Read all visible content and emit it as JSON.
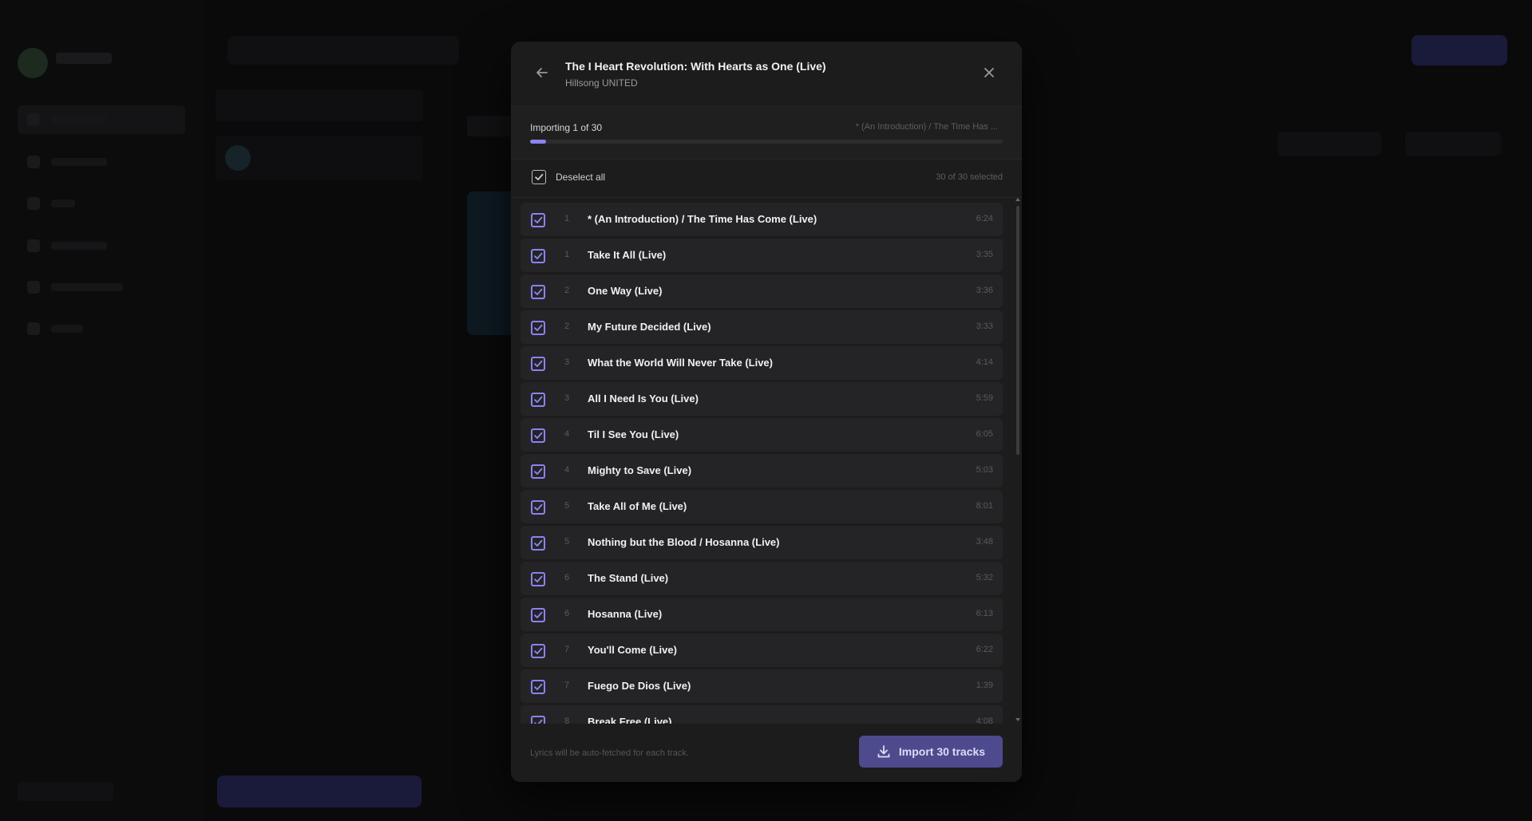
{
  "modal": {
    "title": "The I Heart Revolution: With Hearts as One (Live)",
    "artist": "Hillsong UNITED"
  },
  "progress": {
    "label": "Importing 1 of 30",
    "current_track": "* (An Introduction) / The Time Has ...",
    "fraction": 0.033
  },
  "selection": {
    "toggle_label": "Deselect all",
    "count_label": "30 of 30 selected"
  },
  "tracks": [
    {
      "num": "1",
      "name": "* (An Introduction) / The Time Has Come (Live)",
      "duration": "6:24"
    },
    {
      "num": "1",
      "name": "Take It All (Live)",
      "duration": "3:35"
    },
    {
      "num": "2",
      "name": "One Way (Live)",
      "duration": "3:36"
    },
    {
      "num": "2",
      "name": "My Future Decided (Live)",
      "duration": "3:33"
    },
    {
      "num": "3",
      "name": "What the World Will Never Take (Live)",
      "duration": "4:14"
    },
    {
      "num": "3",
      "name": "All I Need Is You (Live)",
      "duration": "5:59"
    },
    {
      "num": "4",
      "name": "Til I See You (Live)",
      "duration": "6:05"
    },
    {
      "num": "4",
      "name": "Mighty to Save (Live)",
      "duration": "5:03"
    },
    {
      "num": "5",
      "name": "Take All of Me (Live)",
      "duration": "8:01"
    },
    {
      "num": "5",
      "name": "Nothing but the Blood / Hosanna (Live)",
      "duration": "3:48"
    },
    {
      "num": "6",
      "name": "The Stand (Live)",
      "duration": "5:32"
    },
    {
      "num": "6",
      "name": "Hosanna (Live)",
      "duration": "6:13"
    },
    {
      "num": "7",
      "name": "You'll Come (Live)",
      "duration": "6:22"
    },
    {
      "num": "7",
      "name": "Fuego De Dios (Live)",
      "duration": "1:39"
    },
    {
      "num": "8",
      "name": "Break Free (Live)",
      "duration": "4:08"
    }
  ],
  "footer": {
    "note": "Lyrics will be auto-fetched for each track.",
    "import_label": "Import 30 tracks"
  },
  "icons": {
    "back": "arrow-left-icon",
    "close": "close-icon",
    "check": "check-icon",
    "import": "download-icon"
  },
  "colors": {
    "accent": "#8b83f0",
    "button": "#4d4a8e",
    "modal_bg": "#1c1c1d",
    "row_bg": "#242426"
  }
}
